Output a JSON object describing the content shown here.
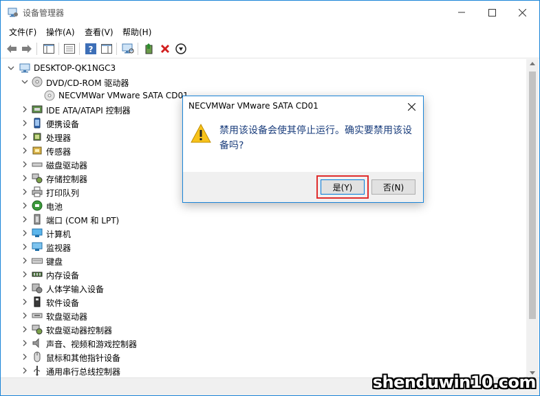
{
  "window": {
    "title": "设备管理器",
    "accent_color": "#1883d7"
  },
  "menu": [
    {
      "label": "文件(F)"
    },
    {
      "label": "操作(A)"
    },
    {
      "label": "查看(V)"
    },
    {
      "label": "帮助(H)"
    }
  ],
  "toolbar": {
    "icons": [
      "back-arrow-icon",
      "forward-arrow-icon",
      "properties-pane-icon",
      "show-hidden-icon",
      "help-icon",
      "action-pane-icon",
      "scan-hardware-icon",
      "update-driver-icon",
      "uninstall-icon",
      "disable-device-icon"
    ]
  },
  "tree": {
    "root": "DESKTOP-QK1NGC3",
    "items": [
      {
        "label": "DVD/CD-ROM 驱动器",
        "expanded": true,
        "icon": "dvd-drive-icon"
      },
      {
        "label": "NECVMWar VMware SATA CD01",
        "child": true,
        "icon": "cd-device-icon"
      },
      {
        "label": "IDE ATA/ATAPI 控制器",
        "icon": "ide-controller-icon"
      },
      {
        "label": "便携设备",
        "icon": "portable-device-icon"
      },
      {
        "label": "处理器",
        "icon": "processor-icon"
      },
      {
        "label": "传感器",
        "icon": "sensor-icon"
      },
      {
        "label": "磁盘驱动器",
        "icon": "disk-drive-icon"
      },
      {
        "label": "存储控制器",
        "icon": "storage-controller-icon"
      },
      {
        "label": "打印队列",
        "icon": "printer-icon"
      },
      {
        "label": "电池",
        "icon": "battery-icon"
      },
      {
        "label": "端口 (COM 和 LPT)",
        "icon": "port-icon"
      },
      {
        "label": "计算机",
        "icon": "computer-icon"
      },
      {
        "label": "监视器",
        "icon": "monitor-icon"
      },
      {
        "label": "键盘",
        "icon": "keyboard-icon"
      },
      {
        "label": "内存设备",
        "icon": "memory-icon"
      },
      {
        "label": "人体学输入设备",
        "icon": "hid-icon"
      },
      {
        "label": "软件设备",
        "icon": "software-device-icon"
      },
      {
        "label": "软盘驱动器",
        "icon": "floppy-drive-icon"
      },
      {
        "label": "软盘驱动器控制器",
        "icon": "floppy-controller-icon"
      },
      {
        "label": "声音、视频和游戏控制器",
        "icon": "sound-icon"
      },
      {
        "label": "鼠标和其他指针设备",
        "icon": "mouse-icon"
      },
      {
        "label": "通用串行总线控制器",
        "icon": "usb-icon"
      }
    ]
  },
  "dialog": {
    "title": "NECVMWar VMware SATA CD01",
    "message": "禁用该设备会使其停止运行。确实要禁用该设备吗?",
    "yes_label": "是(Y)",
    "no_label": "否(N)",
    "highlight_color": "#e02b2b"
  },
  "watermark": "shenduwin10.com"
}
